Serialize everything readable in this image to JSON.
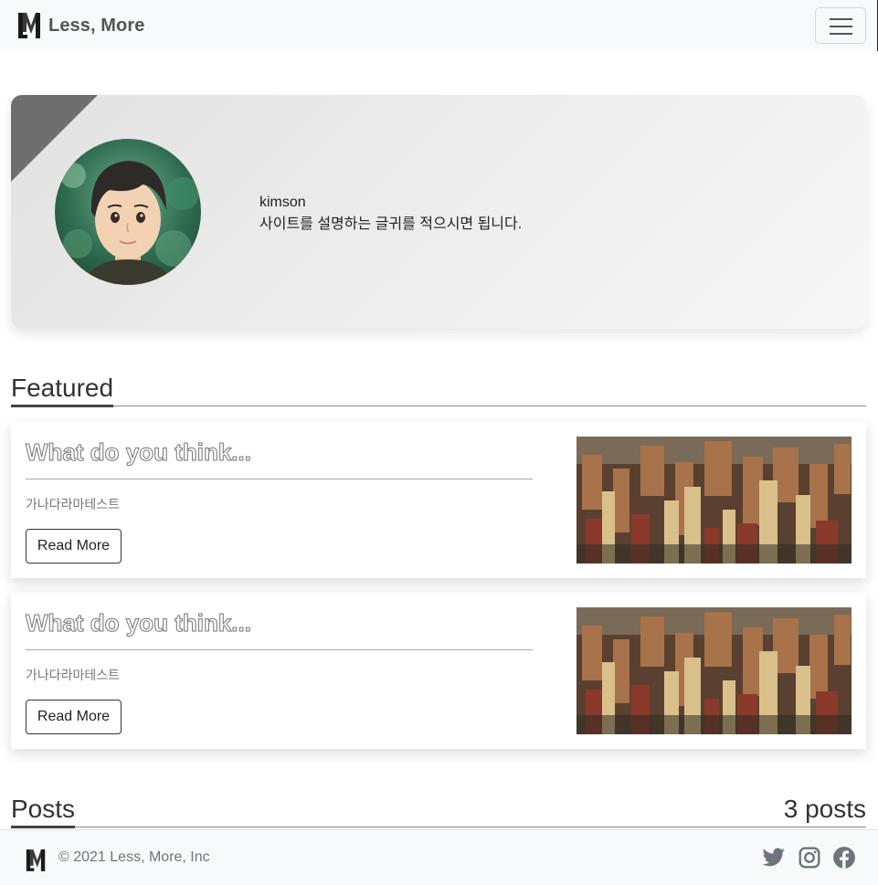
{
  "brand": {
    "name": "Less, More"
  },
  "profile": {
    "name": "kimson",
    "description": "사이트를 설명하는 글귀를 적으시면 됩니다."
  },
  "featured": {
    "heading": "Featured",
    "cards": [
      {
        "title": "What do you think...",
        "subtitle": "가나다라마테스트",
        "button_label": "Read More"
      },
      {
        "title": "What do you think...",
        "subtitle": "가나다라마테스트",
        "button_label": "Read More"
      }
    ]
  },
  "posts": {
    "heading": "Posts",
    "count_label": "3 posts"
  },
  "footer": {
    "copyright": "© 2021 Less, More, Inc"
  },
  "icons": {
    "menu": "hamburger-menu-icon",
    "social": [
      "twitter-icon",
      "instagram-icon",
      "facebook-icon"
    ]
  },
  "colors": {
    "navbar_bg": "#f8f9fa",
    "text_dark": "#212529",
    "muted": "#6c757d",
    "corner": "#6e6e6e"
  }
}
